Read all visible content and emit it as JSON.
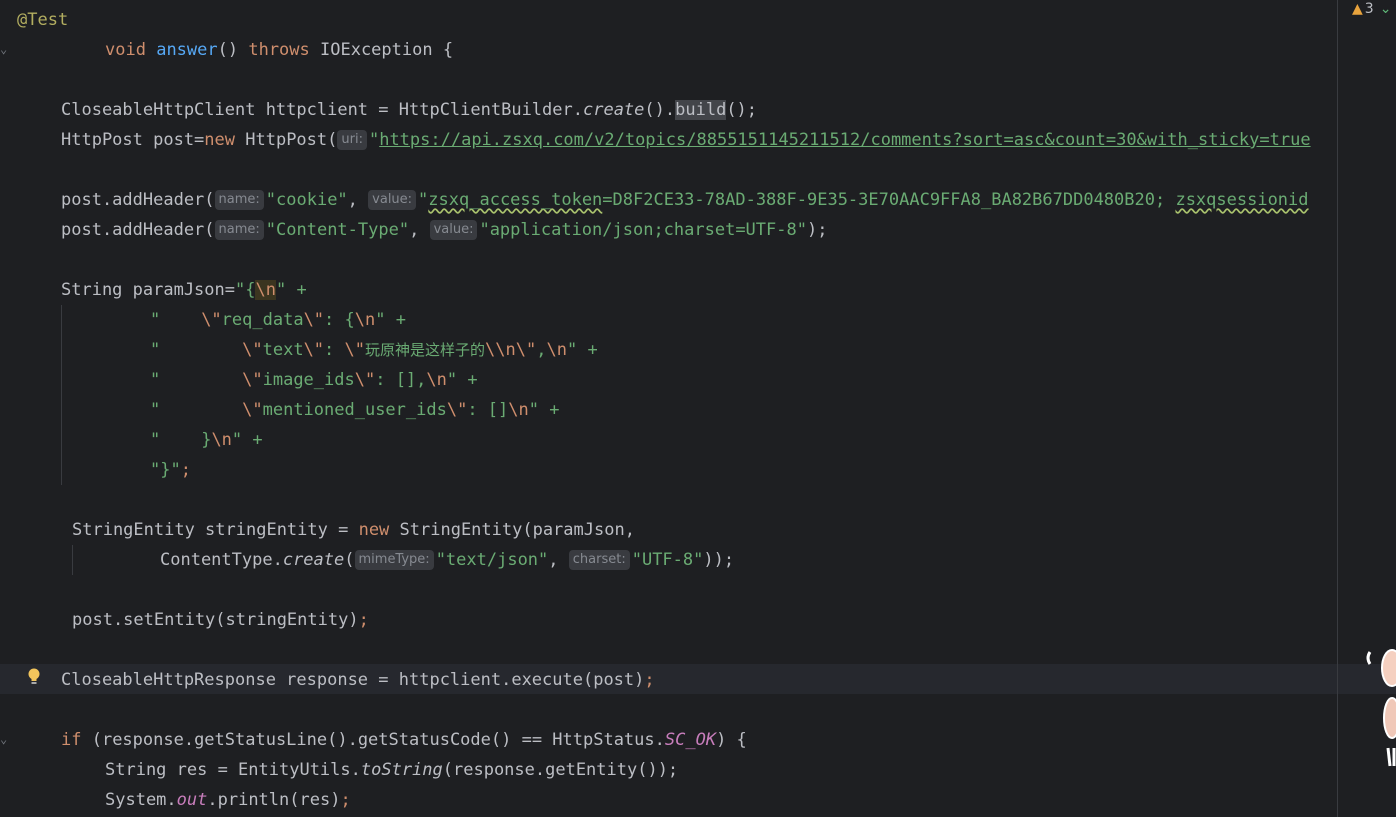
{
  "editor": {
    "warnings_count": "3",
    "tokens": {
      "annotation": "@Test",
      "void": "void",
      "answer": "answer",
      "throws_part1": "() ",
      "throws": "throws",
      "ioexception": " IOException {",
      "l3_a": "CloseableHttpClient httpclient = HttpClientBuilder.",
      "l3_create": "create",
      "l3_b": "().",
      "l3_build": "build",
      "l3_c": "();",
      "l4_a": "HttpPost post=",
      "l4_new": "new",
      "l4_b": " HttpPost(",
      "hint_uri": "uri:",
      "l4_q": "\"",
      "l4_url": "https://api.zsxq.com/v2/topics/885515114521151​2/comments?sort=asc&count=30&with_sticky=true",
      "l6_a": "post.addHeader(",
      "hint_name": "name:",
      "l6_s1": "\"cookie\"",
      "comma_sp": ", ",
      "hint_value": "value:",
      "l6_s2a": "\"",
      "l6_s2b": "zsxq_access_token",
      "l6_s2c": "=D8F2CE33-78AD-388F-9E35-3E70AAC9FFA8_BA82B67DD0480B20; ",
      "l6_s2d": "zsxqsessionid",
      "l7_s1": "\"Content-Type\"",
      "l7_s2": "\"application/json;charset=UTF-8\"",
      "close_semi": ");",
      "l9_a": "String paramJson=",
      "l9_q": "\"{",
      "n": "\\n",
      "q_plus": "\" +",
      "l10_a": "\"    ",
      "bsq": "\\\"",
      "l10_b": "req_data",
      "l10_c": ": {",
      "l11_a": "\"        ",
      "l11_b": "text",
      "l11_c": ": ",
      "l11_d": "玩原神是这样子的",
      "l11_e": "\\\\n",
      "l11_f": ",",
      "l12_b": "image_ids",
      "l12_c": ": [],",
      "l13_b": "mentioned_user_ids",
      "l13_c": ": []",
      "l14_b": "}",
      "l15": "\"}\"",
      "semi": ";",
      "l17_a": "StringEntity stringEntity = ",
      "l17_new": "new",
      "l17_b": " StringEntity(paramJson,",
      "l18_a": "ContentType.",
      "l18_create": "create",
      "l18_b": "(",
      "hint_mime": "mimeType:",
      "l18_s1": "\"text/json\"",
      "hint_charset": "charset:",
      "l18_s2": "\"UTF-8\"",
      "l18_c": "));",
      "l20": "post.setEntity(stringEntity)",
      "l22": "CloseableHttpResponse response = httpclient.execute(post)",
      "l24_if": "if",
      "l24_a": " (response.getStatusLine().getStatusCode() == HttpStatus.",
      "l24_f": "SC_OK",
      "l24_b": ") {",
      "l25_a": "String res = EntityUtils.",
      "l25_m": "toString",
      "l25_b": "(response.getEntity());",
      "l26_a": "System.",
      "l26_f": "out",
      "l26_b": ".println(res)"
    }
  }
}
